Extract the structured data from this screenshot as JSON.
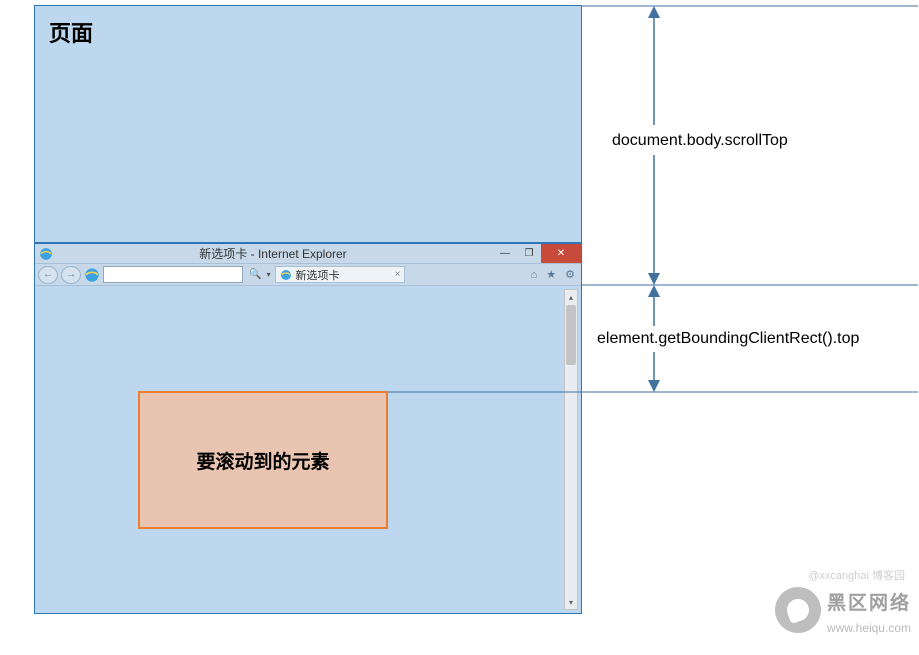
{
  "page": {
    "label": "页面"
  },
  "browser": {
    "title": "新选项卡 - Internet Explorer",
    "tab_label": "新选项卡",
    "url": ""
  },
  "target": {
    "label": "要滚动到的元素"
  },
  "annotations": {
    "scrollTop": "document.body.scrollTop",
    "rectTop": "element.getBoundingClientRect().top"
  },
  "watermark": {
    "brand": "黑区网络",
    "url": "www.heiqu.com",
    "credit": "@xxcanghai  博客园"
  },
  "colors": {
    "page_fill": "#bdd7ee",
    "page_border": "#2e76b6",
    "target_fill": "#e9c4b0",
    "target_border": "#ed7d31",
    "arrow": "#41729f"
  }
}
